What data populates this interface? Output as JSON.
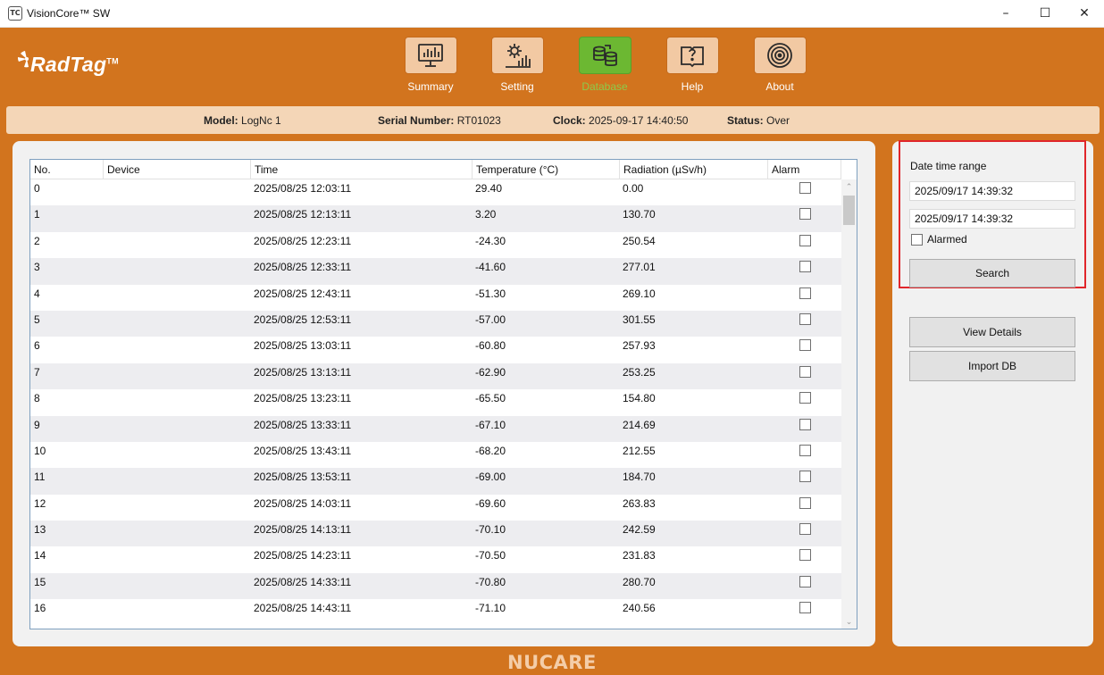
{
  "window": {
    "title": "VisionCore™ SW",
    "app_icon_text": "TC",
    "minimize": "–",
    "maximize": "☐",
    "close": "✕"
  },
  "logo": {
    "text": "RadTag",
    "tm": "TM"
  },
  "nav": [
    {
      "label": "Summary",
      "icon": "monitor-chart-icon",
      "active": false
    },
    {
      "label": "Setting",
      "icon": "gear-chart-icon",
      "active": false
    },
    {
      "label": "Database",
      "icon": "database-icon",
      "active": true
    },
    {
      "label": "Help",
      "icon": "help-book-icon",
      "active": false
    },
    {
      "label": "About",
      "icon": "target-icon",
      "active": false
    }
  ],
  "info": {
    "model_label": "Model:",
    "model_value": "LogNc 1",
    "serial_label": "Serial Number:",
    "serial_value": "RT01023",
    "clock_label": "Clock:",
    "clock_value": "2025-09-17 14:40:50",
    "status_label": "Status:",
    "status_value": "Over"
  },
  "table": {
    "columns": [
      "No.",
      "Device",
      "Time",
      "Temperature  (°C)",
      "Radiation  (µSv/h)",
      "Alarm"
    ],
    "rows": [
      {
        "no": "0",
        "device": "",
        "time": "2025/08/25 12:03:11",
        "temp": "29.40",
        "rad": "0.00",
        "alarm": false
      },
      {
        "no": "1",
        "device": "",
        "time": "2025/08/25 12:13:11",
        "temp": "3.20",
        "rad": "130.70",
        "alarm": false
      },
      {
        "no": "2",
        "device": "",
        "time": "2025/08/25 12:23:11",
        "temp": "-24.30",
        "rad": "250.54",
        "alarm": false
      },
      {
        "no": "3",
        "device": "",
        "time": "2025/08/25 12:33:11",
        "temp": "-41.60",
        "rad": "277.01",
        "alarm": false
      },
      {
        "no": "4",
        "device": "",
        "time": "2025/08/25 12:43:11",
        "temp": "-51.30",
        "rad": "269.10",
        "alarm": false
      },
      {
        "no": "5",
        "device": "",
        "time": "2025/08/25 12:53:11",
        "temp": "-57.00",
        "rad": "301.55",
        "alarm": false
      },
      {
        "no": "6",
        "device": "",
        "time": "2025/08/25 13:03:11",
        "temp": "-60.80",
        "rad": "257.93",
        "alarm": false
      },
      {
        "no": "7",
        "device": "",
        "time": "2025/08/25 13:13:11",
        "temp": "-62.90",
        "rad": "253.25",
        "alarm": false
      },
      {
        "no": "8",
        "device": "",
        "time": "2025/08/25 13:23:11",
        "temp": "-65.50",
        "rad": "154.80",
        "alarm": false
      },
      {
        "no": "9",
        "device": "",
        "time": "2025/08/25 13:33:11",
        "temp": "-67.10",
        "rad": "214.69",
        "alarm": false
      },
      {
        "no": "10",
        "device": "",
        "time": "2025/08/25 13:43:11",
        "temp": "-68.20",
        "rad": "212.55",
        "alarm": false
      },
      {
        "no": "11",
        "device": "",
        "time": "2025/08/25 13:53:11",
        "temp": "-69.00",
        "rad": "184.70",
        "alarm": false
      },
      {
        "no": "12",
        "device": "",
        "time": "2025/08/25 14:03:11",
        "temp": "-69.60",
        "rad": "263.83",
        "alarm": false
      },
      {
        "no": "13",
        "device": "",
        "time": "2025/08/25 14:13:11",
        "temp": "-70.10",
        "rad": "242.59",
        "alarm": false
      },
      {
        "no": "14",
        "device": "",
        "time": "2025/08/25 14:23:11",
        "temp": "-70.50",
        "rad": "231.83",
        "alarm": false
      },
      {
        "no": "15",
        "device": "",
        "time": "2025/08/25 14:33:11",
        "temp": "-70.80",
        "rad": "280.70",
        "alarm": false
      },
      {
        "no": "16",
        "device": "",
        "time": "2025/08/25 14:43:11",
        "temp": "-71.10",
        "rad": "240.56",
        "alarm": false
      }
    ]
  },
  "side": {
    "range_label": "Date time range",
    "start_value": "2025/09/17 14:39:32",
    "end_value": "2025/09/17 14:39:32",
    "alarmed_label": "Alarmed",
    "alarmed_checked": false,
    "search_label": "Search",
    "view_details_label": "View Details",
    "import_db_label": "Import DB"
  },
  "footer": {
    "brand": "NUCARE"
  },
  "colors": {
    "background": "#D2741E",
    "nav_tile": "#F2C9A3",
    "nav_active": "#6CB832",
    "infobar": "#F4D6B7",
    "highlight": "#E0262B"
  }
}
